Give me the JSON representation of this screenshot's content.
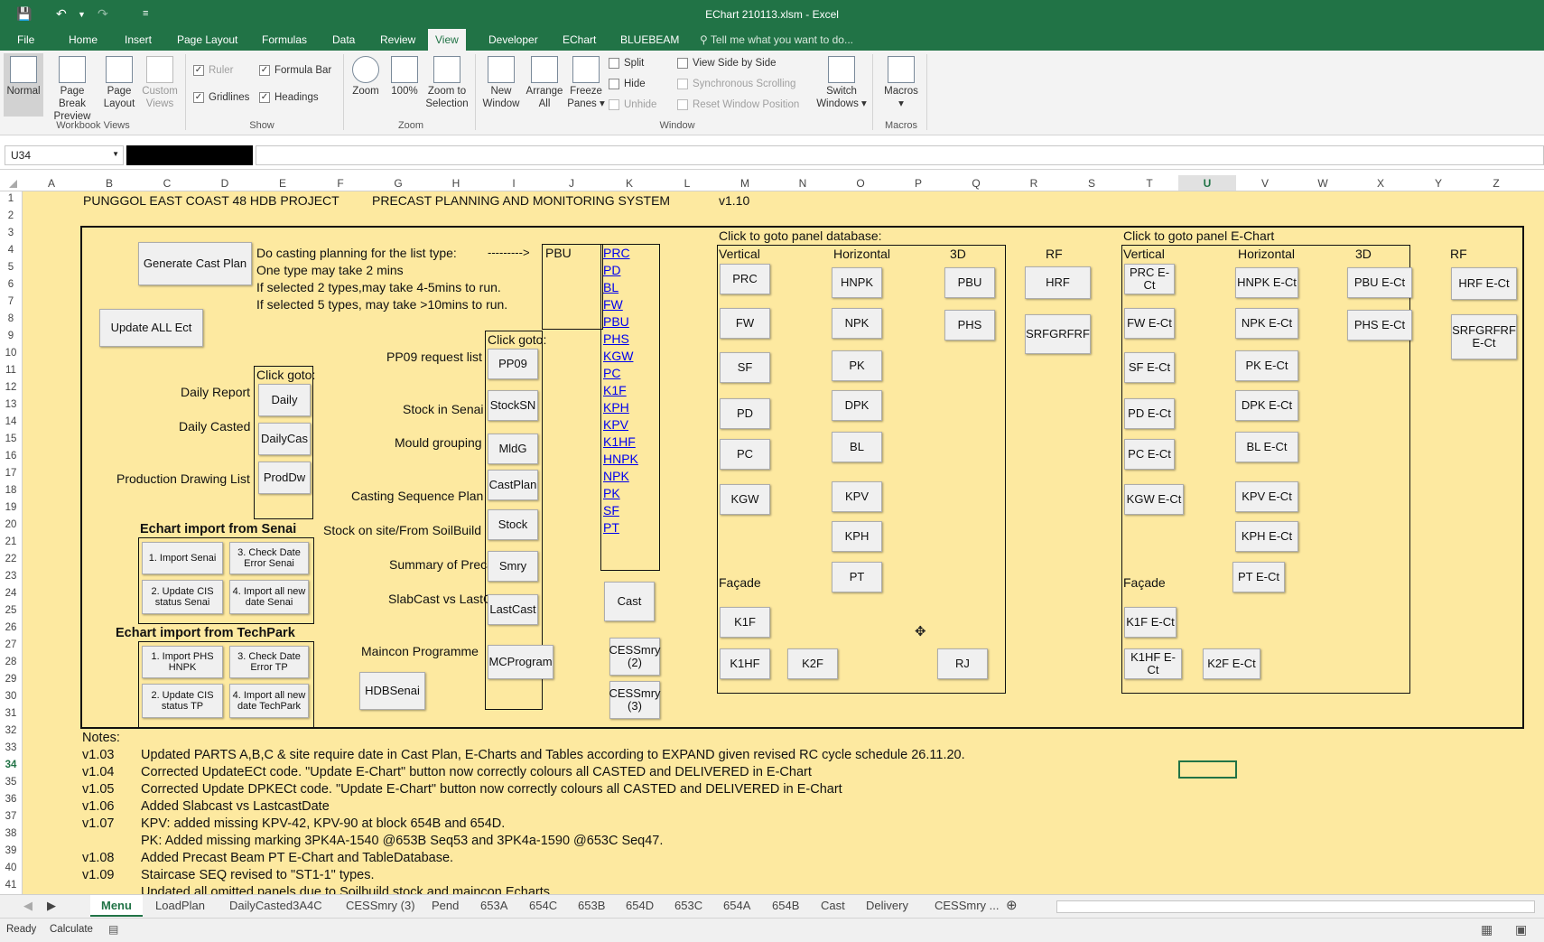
{
  "title_bar": {
    "title": "EChart 210113.xlsm - Excel"
  },
  "menu": {
    "tabs": [
      "File",
      "Home",
      "Insert",
      "Page Layout",
      "Formulas",
      "Data",
      "Review",
      "View",
      "Developer",
      "EChart",
      "BLUEBEAM"
    ],
    "active": "View",
    "tell_me": "Tell me what you want to do..."
  },
  "ribbon": {
    "workbook_views": {
      "label": "Workbook Views",
      "normal": "Normal",
      "page_break": "Page Break Preview",
      "page_layout": "Page Layout",
      "custom": "Custom Views"
    },
    "show": {
      "label": "Show",
      "ruler": "Ruler",
      "formula_bar": "Formula Bar",
      "gridlines": "Gridlines",
      "headings": "Headings"
    },
    "zoom": {
      "label": "Zoom",
      "zoom": "Zoom",
      "z100": "100%",
      "zoom_sel": "Zoom to Selection"
    },
    "window": {
      "label": "Window",
      "new_window": "New Window",
      "arrange_all": "Arrange All",
      "freeze_panes": "Freeze Panes",
      "split": "Split",
      "hide": "Hide",
      "unhide": "Unhide",
      "side_by_side": "View Side by Side",
      "sync_scroll": "Synchronous Scrolling",
      "reset_pos": "Reset Window Position",
      "switch": "Switch Windows"
    },
    "macros": {
      "label": "Macros",
      "macros": "Macros"
    }
  },
  "formula_bar": {
    "name_box": "U34",
    "formula": ""
  },
  "columns": [
    "A",
    "B",
    "C",
    "D",
    "E",
    "F",
    "G",
    "H",
    "I",
    "J",
    "K",
    "L",
    "M",
    "N",
    "O",
    "P",
    "Q",
    "R",
    "S",
    "T",
    "U",
    "V",
    "W",
    "X",
    "Y",
    "Z"
  ],
  "rows": [
    "1",
    "2",
    "3",
    "4",
    "5",
    "6",
    "7",
    "8",
    "9",
    "10",
    "11",
    "12",
    "13",
    "14",
    "15",
    "16",
    "17",
    "18",
    "19",
    "20",
    "21",
    "22",
    "23",
    "24",
    "25",
    "26",
    "27",
    "28",
    "29",
    "30",
    "31",
    "32",
    "33",
    "34",
    "35",
    "36",
    "37",
    "38",
    "39",
    "40",
    "41"
  ],
  "sheet": {
    "title_project": "PUNGGOL EAST COAST 48 HDB PROJECT",
    "title_system": "PRECAST PLANNING AND MONITORING SYSTEM",
    "version": "v1.10",
    "gen_cast_plan": "Generate Cast Plan",
    "cast_info": [
      "Do casting planning for the list type:",
      "One type may take 2 mins",
      "If selected 2 types,may take 4-5mins to run.",
      "If selected 5 types, may take >10mins to run."
    ],
    "arrow": "--------->",
    "pbu_label": "PBU",
    "type_links": [
      "PRC",
      "PD",
      "BL",
      "FW",
      "PBU",
      "PHS",
      "KGW",
      "PC",
      "K1F",
      "KPH",
      "KPV",
      "K1HF",
      "HNPK",
      "NPK",
      "PK",
      "SF",
      "PT"
    ],
    "update_all": "Update ALL Ect",
    "click_goto": "Click goto:",
    "daily_report": "Daily Report",
    "daily_casted": "Daily Casted",
    "prod_list": "Production Drawing List",
    "btn_daily": "Daily",
    "btn_dailycas": "DailyCas",
    "btn_prodw": "ProdDw",
    "senai_hdr": "Echart import from Senai",
    "senai_btns": [
      "1. Import Senai",
      "3. Check Date Error Senai",
      "2. Update CIS status Senai",
      "4. Import all new date Senai"
    ],
    "tp_hdr": "Echart import from TechPark",
    "tp_btns": [
      "1. Import PHS HNPK",
      "3. Check Date Error TP",
      "2. Update CIS status TP",
      "4. Import all new date TechPark"
    ],
    "click_goto2": "Click goto:",
    "goto_labels": [
      "PP09 request list",
      "Stock in Senai",
      "Mould grouping",
      "Casting Sequence Plan",
      "Stock on site/From SoilBuild",
      "Summary of Precast",
      "SlabCast vs LastCast",
      "Maincon Programme"
    ],
    "goto_btns": [
      "PP09",
      "StockSN",
      "MldG",
      "CastPlan",
      "Stock",
      "Smry",
      "LastCast",
      "MCProgram"
    ],
    "hdbsenai": "HDBSenai",
    "cast": "Cast",
    "cessmry2": "CESSmry (2)",
    "cessmry3": "CESSmry (3)",
    "db_hdr": "Click to goto panel database:",
    "echart_hdr": "Click to goto panel E-Chart",
    "sub_vertical": "Vertical",
    "sub_horizontal": "Horizontal",
    "sub_3d": "3D",
    "sub_rf": "RF",
    "facade": "Façade",
    "db_vertical": [
      "PRC",
      "FW",
      "SF",
      "PD",
      "PC",
      "KGW"
    ],
    "db_horizontal": [
      "HNPK",
      "NPK",
      "PK",
      "DPK",
      "BL",
      "KPV",
      "KPH",
      "PT"
    ],
    "db_3d": [
      "PBU",
      "PHS"
    ],
    "db_rf": [
      "HRF",
      "SRFGRFRF"
    ],
    "db_facade": [
      "K1F",
      "K1HF",
      "K2F",
      "RJ"
    ],
    "ec_vertical": [
      "PRC E-Ct",
      "FW E-Ct",
      "SF E-Ct",
      "PD E-Ct",
      "PC E-Ct",
      "KGW E-Ct"
    ],
    "ec_horizontal": [
      "HNPK E-Ct",
      "NPK E-Ct",
      "PK E-Ct",
      "DPK E-Ct",
      "BL E-Ct",
      "KPV E-Ct",
      "KPH E-Ct",
      "PT E-Ct"
    ],
    "ec_3d": [
      "PBU E-Ct",
      "PHS E-Ct"
    ],
    "ec_rf": [
      "HRF E-Ct",
      "SRFGRFRF E-Ct"
    ],
    "ec_facade": [
      "K1F E-Ct",
      "K1HF E-Ct",
      "K2F E-Ct"
    ],
    "notes_hdr": "Notes:",
    "notes": [
      {
        "v": "v1.03",
        "t": "Updated PARTS A,B,C & site require date in Cast Plan, E-Charts and Tables according to EXPAND given revised RC cycle schedule 26.11.20."
      },
      {
        "v": "v1.04",
        "t": "Corrected UpdateECt code. \"Update E-Chart\" button now correctly colours all CASTED and DELIVERED in E-Chart"
      },
      {
        "v": "v1.05",
        "t": "Corrected Update DPKECt code. \"Update E-Chart\" button now correctly colours all CASTED and DELIVERED in E-Chart"
      },
      {
        "v": "v1.06",
        "t": "Added Slabcast vs LastcastDate"
      },
      {
        "v": "v1.07",
        "t": "KPV: added missing KPV-42, KPV-90 at block 654B and 654D."
      },
      {
        "v": "",
        "t": "PK: Added missing marking 3PK4A-1540 @653B Seq53 and 3PK4a-1590 @653C Seq47."
      },
      {
        "v": "v1.08",
        "t": "Added Precast Beam PT E-Chart and TableDatabase."
      },
      {
        "v": "v1.09",
        "t": "Staircase SEQ revised to \"ST1-1\" types."
      },
      {
        "v": "",
        "t": "Updated all omitted panels due to Soilbuild stock and maincon Echarts"
      }
    ]
  },
  "sheet_tabs": [
    "Menu",
    "LoadPlan",
    "DailyCasted3A4C",
    "CESSmry (3)",
    "Pend",
    "653A",
    "654C",
    "653B",
    "654D",
    "653C",
    "654A",
    "654B",
    "Cast",
    "Delivery",
    "CESSmry ..."
  ],
  "status": {
    "ready": "Ready",
    "calculate": "Calculate"
  }
}
